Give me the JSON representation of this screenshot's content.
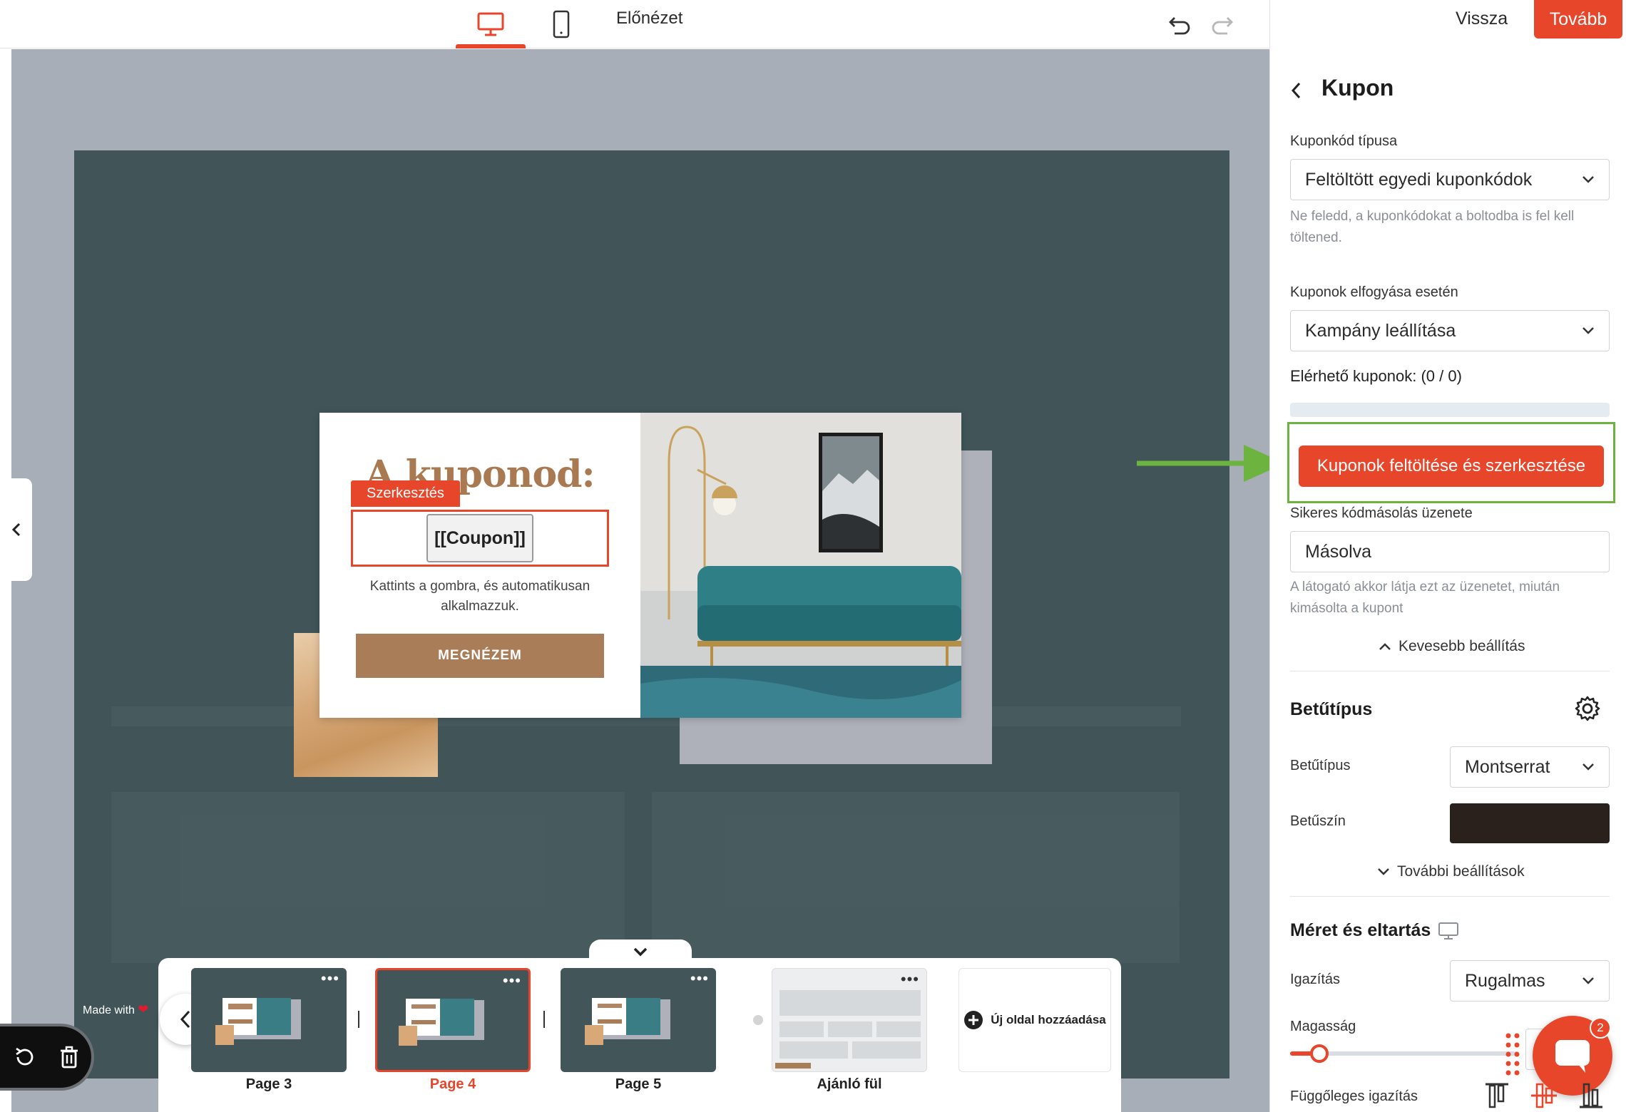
{
  "topbar": {
    "preview_label": "Előnézet",
    "back_label": "Vissza",
    "next_label": "Tovább"
  },
  "popup": {
    "title": "A kuponod:",
    "edit_tag": "Szerkesztés",
    "coupon_code": "[[Coupon]]",
    "description": "Kattints a gombra, és automatikusan alkalmazzuk.",
    "cta_label": "MEGNÉZEM"
  },
  "footer": {
    "made_with": "Made with"
  },
  "pages": {
    "items": [
      {
        "label": "Page 3"
      },
      {
        "label": "Page 4"
      },
      {
        "label": "Page 5"
      },
      {
        "label": "Ajánló fül"
      }
    ],
    "add_label": "Új oldal hozzáadása",
    "active_index": 1
  },
  "panel": {
    "title": "Kupon",
    "coupon_type_label": "Kuponkód típusa",
    "coupon_type_value": "Feltöltött egyedi kuponkódok",
    "coupon_type_hint": "Ne feledd, a kuponkódokat a boltodba is fel kell töltened.",
    "on_run_out_label": "Kuponok elfogyása esetén",
    "on_run_out_value": "Kampány leállítása",
    "available_label": "Elérhető kuponok: (0 / 0)",
    "available_fraction": 0,
    "upload_button": "Kuponok feltöltése és szerkesztése",
    "copy_msg_label": "Sikeres kódmásolás üzenete",
    "copy_msg_value": "Másolva",
    "copy_msg_hint": "A látogató akkor látja ezt az üzenetet, miután kimásolta a kupont",
    "less_settings": "Kevesebb beállítás",
    "font_section": "Betűtípus",
    "font_label": "Betűtípus",
    "font_value": "Montserrat",
    "font_color_label": "Betűszín",
    "font_color": "#2b211c",
    "more_settings": "További beállítások",
    "size_section": "Méret és eltartás",
    "align_label": "Igazítás",
    "align_value": "Rugalmas",
    "height_label": "Magasság",
    "valign_label": "Függőleges igazítás",
    "chat_badge": "2"
  },
  "colors": {
    "accent": "#e8462a",
    "canvas": "#415559",
    "workspace": "#a7aeb7",
    "highlight": "#6db33f",
    "cta_brown": "#a87d57"
  }
}
